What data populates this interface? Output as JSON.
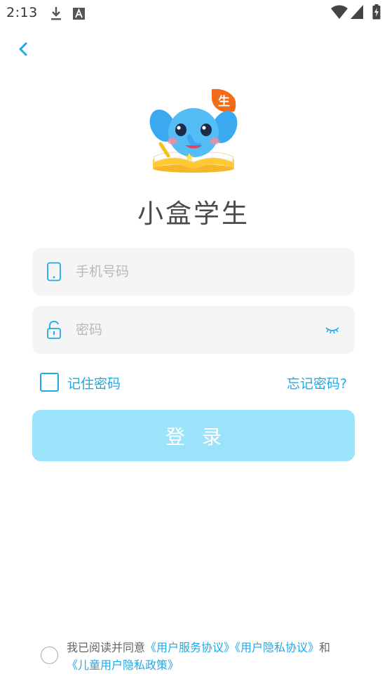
{
  "status_bar": {
    "time": "2:13",
    "icons": [
      "download-icon",
      "font-a-icon",
      "wifi-icon",
      "signal-icon",
      "battery-icon"
    ]
  },
  "header": {
    "back_icon": "chevron-left-icon"
  },
  "app": {
    "name": "小盒学生",
    "logo_badge": "生"
  },
  "form": {
    "phone": {
      "placeholder": "手机号码",
      "value": "",
      "icon": "phone-icon"
    },
    "password": {
      "placeholder": "密码",
      "value": "",
      "icon": "lock-icon",
      "toggle_icon": "eye-closed-icon"
    },
    "remember_label": "记住密码",
    "remember_checked": false,
    "forgot_label": "忘记密码?",
    "login_label": "登录"
  },
  "agreement": {
    "prefix": "我已阅读并同意",
    "link1": "《用户服务协议》",
    "link2": "《用户隐私协议》",
    "middle": "和",
    "link3": "《儿童用户隐私政策》",
    "checked": false
  },
  "colors": {
    "accent": "#1ea9e8",
    "login_button": "#9be3fa",
    "field_background": "#f5f5f5",
    "badge_orange": "#f36a19"
  }
}
